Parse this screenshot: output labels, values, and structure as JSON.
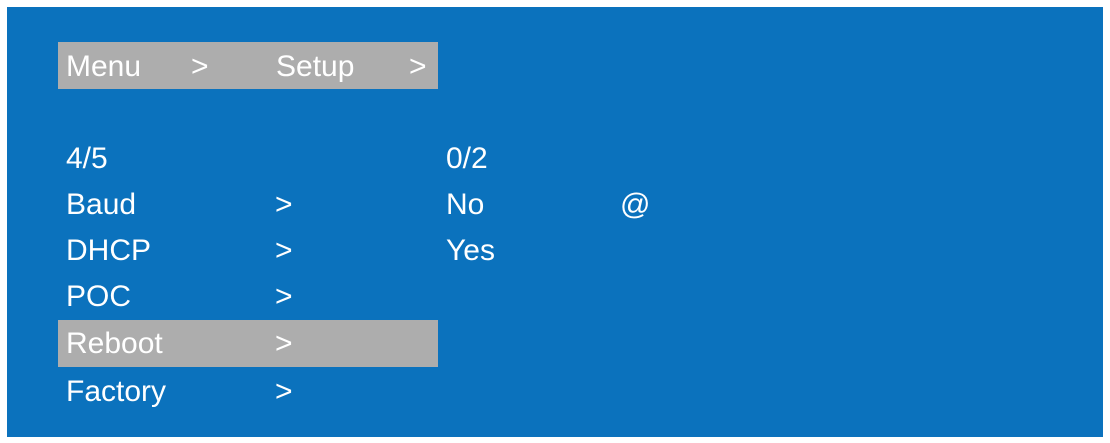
{
  "breadcrumb": {
    "menu": "Menu",
    "sep1": ">",
    "setup": "Setup",
    "sep2": ">"
  },
  "left_list": {
    "position": "4/5",
    "items": [
      {
        "label": "Baud",
        "arrow": ">"
      },
      {
        "label": "DHCP",
        "arrow": ">"
      },
      {
        "label": "POC",
        "arrow": ">"
      },
      {
        "label": "Reboot",
        "arrow": ">",
        "selected": true
      },
      {
        "label": "Factory",
        "arrow": ">"
      }
    ]
  },
  "right_list": {
    "position": "0/2",
    "options": [
      {
        "label": "No",
        "marker": "@"
      },
      {
        "label": "Yes"
      }
    ]
  },
  "colors": {
    "background": "#0b72bd",
    "highlight": "#adadad",
    "text": "#ffffff"
  }
}
